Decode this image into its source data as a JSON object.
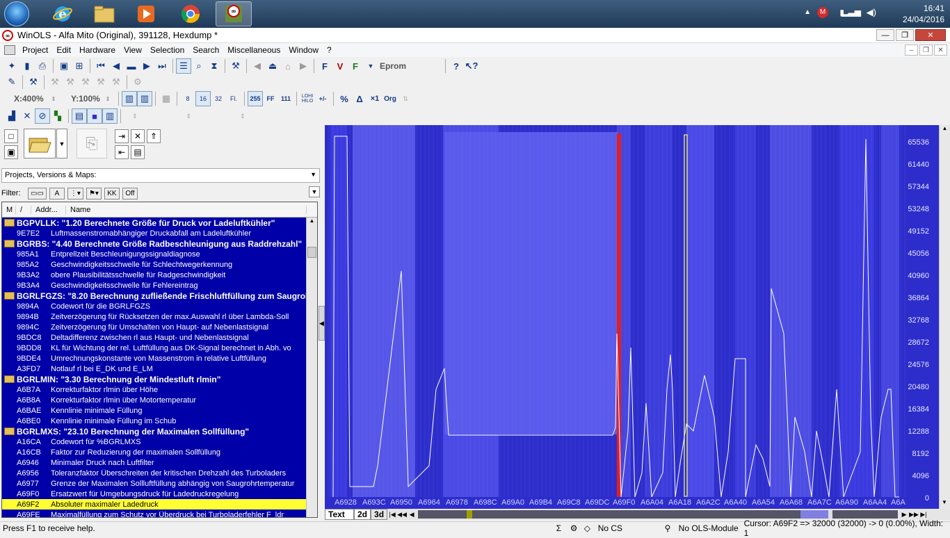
{
  "taskbar": {
    "apps": [
      "windows-explorer",
      "internet-explorer",
      "file-explorer",
      "media-player",
      "chrome",
      "winols"
    ],
    "tray": {
      "clock_time": "16:41",
      "clock_date": "24/04/2016"
    }
  },
  "window": {
    "title": "WinOLS - Alfa Mito (Original), 391128, Hexdump *"
  },
  "menu": [
    "Project",
    "Edit",
    "Hardware",
    "View",
    "Selection",
    "Search",
    "Miscellaneous",
    "Window",
    "?"
  ],
  "toolbar2": {
    "eprom_label": "Eprom"
  },
  "toolbar3": {
    "x_zoom": "X:400%",
    "y_zoom": "Y:100%",
    "btn_8": "8",
    "btn_16": "16",
    "btn_32": "32",
    "btn_fl": "Fl.",
    "btn_255": "255",
    "btn_ff": "FF",
    "btn_111": "111",
    "btn_lohi": "LOHI\nHILO",
    "btn_sign": "+/-",
    "btn_pct": "%",
    "btn_delta": "Δ",
    "btn_x1": "×1",
    "btn_org": "Org"
  },
  "project_panel": {
    "select_label": "Projects, Versions & Maps:",
    "filter_label": "Filter:",
    "filter_off": "Off",
    "columns": {
      "m": "M",
      "sort": "/",
      "addr": "Addr...",
      "name": "Name"
    }
  },
  "maps": [
    {
      "type": "folder",
      "text": "BGPVLLK: \"1.20 Berechnete Größe für Druck vor Ladeluftkühler\""
    },
    {
      "type": "item",
      "addr": "9E7E2",
      "name": "Luftmassenstromabhängiger Druckabfall am Ladeluftkühler"
    },
    {
      "type": "folder",
      "text": "BGRBS: \"4.40 Berechnete Größe Radbeschleunigung aus Raddrehzahl\""
    },
    {
      "type": "item",
      "addr": "985A1",
      "name": "Entprellzeit Beschleunigungssignaldiagnose"
    },
    {
      "type": "item",
      "addr": "985A2",
      "name": "Geschwindigkeitsschwelle für Schlechtwegerkennung"
    },
    {
      "type": "item",
      "addr": "9B3A2",
      "name": "obere Plausibilitätsschwelle für Radgeschwindigkeit"
    },
    {
      "type": "item",
      "addr": "9B3A4",
      "name": "Geschwindigkeitsschwelle für Fehlereintrag"
    },
    {
      "type": "folder",
      "text": "BGRLFGZS: \"8.20 Berechnung zufließende Frischluftfüllung zum Saugroh"
    },
    {
      "type": "item",
      "addr": "9894A",
      "name": "Codewort für die BGRLFGZS"
    },
    {
      "type": "item",
      "addr": "9894B",
      "name": "Zeitverzögerung für Rücksetzen der max.Auswahl rl über Lambda-Soll"
    },
    {
      "type": "item",
      "addr": "9894C",
      "name": "Zeitverzögerung für Umschalten von Haupt- auf Nebenlastsignal"
    },
    {
      "type": "item",
      "addr": "9BDC8",
      "name": "Deltadifferenz zwischen rl aus Haupt- und Nebenlastsignal"
    },
    {
      "type": "item",
      "addr": "9BDD8",
      "name": "KL für Wichtung der rel. Luftfüllung aus DK-Signal berechnet in Abh. vo"
    },
    {
      "type": "item",
      "addr": "9BDE4",
      "name": "Umrechnungskonstante von Massenstrom in relative Luftfüllung"
    },
    {
      "type": "item",
      "addr": "A3FD7",
      "name": "Notlauf rl bei E_DK und E_LM"
    },
    {
      "type": "folder",
      "text": "BGRLMIN: \"3.30 Berechnung der Mindestluft rlmin\""
    },
    {
      "type": "item",
      "addr": "A6B7A",
      "name": "Korrekturfaktor rlmin über Höhe"
    },
    {
      "type": "item",
      "addr": "A6B8A",
      "name": "Korrekturfaktor rlmin über Motortemperatur"
    },
    {
      "type": "item",
      "addr": "A6BAE",
      "name": "Kennlinie minimale Füllung"
    },
    {
      "type": "item",
      "addr": "A6BE0",
      "name": "Kennlinie minimale Füllung im Schub"
    },
    {
      "type": "folder",
      "text": "BGRLMXS: \"23.10 Berechnung der Maximalen Sollfüllung\""
    },
    {
      "type": "item",
      "addr": "A16CA",
      "name": "Codewort für %BGRLMXS"
    },
    {
      "type": "item",
      "addr": "A16CB",
      "name": "Faktor zur Reduzierung der maximalen Sollfüllung"
    },
    {
      "type": "item",
      "addr": "A6946",
      "name": "Minimaler Druck nach Luftfilter"
    },
    {
      "type": "item",
      "addr": "A6956",
      "name": "Toleranzfaktor Überschreiten der kritischen Drehzahl des Turboladers"
    },
    {
      "type": "item",
      "addr": "A6977",
      "name": "Grenze der Maximalen Sollluftfüllung abhängig von Saugrohrtemperatur"
    },
    {
      "type": "item",
      "addr": "A69F0",
      "name": "Ersatzwert für Umgebungsdruck für Ladedruckregelung"
    },
    {
      "type": "item",
      "addr": "A69F2",
      "name": "Absoluter maximaler Ladedruck",
      "selected": true
    },
    {
      "type": "item",
      "addr": "A69FE",
      "name": "Maximalfüllung zum Schutz vor Überdruck bei Turboladerfehler F_ldr"
    }
  ],
  "hexview": {
    "y_ticks": [
      "65536",
      "61440",
      "57344",
      "53248",
      "49152",
      "45056",
      "40960",
      "36864",
      "32768",
      "28672",
      "24576",
      "20480",
      "16384",
      "12288",
      "8192",
      "4096",
      "0"
    ],
    "x_ticks": [
      "A6928",
      "A693C",
      "A6950",
      "A6964",
      "A6978",
      "A698C",
      "A69A0",
      "A69B4",
      "A69C8",
      "A69DC",
      "A69F0",
      "A6A04",
      "A6A18",
      "A6A2C",
      "A6A40",
      "A6A54",
      "A6A68",
      "A6A7C",
      "A6A90",
      "A6AA4",
      "A6A"
    ],
    "tabs": [
      "Text",
      "2d",
      "3d"
    ]
  },
  "status": {
    "help": "Press F1 to receive help.",
    "cs": "No CS",
    "ols_module": "No OLS-Module",
    "cursor": "Cursor: A69F2 => 32000 (32000) -> 0 (0.00%), Width: 1"
  }
}
